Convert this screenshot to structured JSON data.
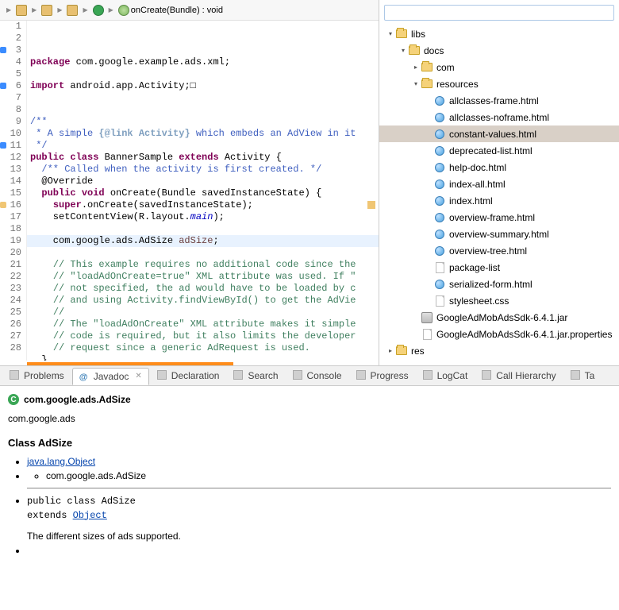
{
  "breadcrumb": {
    "method": "onCreate(Bundle) : void"
  },
  "code": {
    "lines": [
      {
        "n": 1,
        "segs": [
          {
            "t": "package ",
            "c": "kw"
          },
          {
            "t": "com.google.example.ads.xml;"
          }
        ]
      },
      {
        "n": 2,
        "segs": []
      },
      {
        "n": 3,
        "segs": [
          {
            "t": "import ",
            "c": "kw"
          },
          {
            "t": "android.app.Activity;"
          },
          {
            "t": "□",
            "c": "typ"
          }
        ],
        "mark": "blue"
      },
      {
        "n": 4,
        "segs": []
      },
      {
        "n": 5,
        "segs": []
      },
      {
        "n": 6,
        "segs": [
          {
            "t": "/**",
            "c": "jd"
          }
        ],
        "mark": "blue"
      },
      {
        "n": 7,
        "segs": [
          {
            "t": " * A simple ",
            "c": "jd"
          },
          {
            "t": "{@link Activity}",
            "c": "jdt"
          },
          {
            "t": " which embeds an AdView in it",
            "c": "jd"
          }
        ]
      },
      {
        "n": 8,
        "segs": [
          {
            "t": " */",
            "c": "jd"
          }
        ]
      },
      {
        "n": 9,
        "segs": [
          {
            "t": "public class ",
            "c": "kw"
          },
          {
            "t": "BannerSample "
          },
          {
            "t": "extends ",
            "c": "kw"
          },
          {
            "t": "Activity {"
          }
        ]
      },
      {
        "n": 10,
        "segs": [
          {
            "t": "  "
          },
          {
            "t": "/** Called when the activity is first created. */",
            "c": "jd"
          }
        ]
      },
      {
        "n": 11,
        "segs": [
          {
            "t": "  "
          },
          {
            "t": "@Override",
            "c": "typ"
          }
        ],
        "mark": "blue"
      },
      {
        "n": 12,
        "segs": [
          {
            "t": "  "
          },
          {
            "t": "public void ",
            "c": "kw"
          },
          {
            "t": "onCreate(Bundle savedInstanceState) {"
          }
        ]
      },
      {
        "n": 13,
        "segs": [
          {
            "t": "    "
          },
          {
            "t": "super",
            "c": "kw"
          },
          {
            "t": ".onCreate(savedInstanceState);"
          }
        ]
      },
      {
        "n": 14,
        "segs": [
          {
            "t": "    setContentView(R.layout."
          },
          {
            "t": "main",
            "c": "fld"
          },
          {
            "t": ");"
          }
        ]
      },
      {
        "n": 15,
        "segs": []
      },
      {
        "n": 16,
        "segs": [
          {
            "t": "    com.google.ads.AdSize "
          },
          {
            "t": "adSize",
            "c": "var"
          },
          {
            "t": ";"
          }
        ],
        "hl": true,
        "mark": "yellow"
      },
      {
        "n": 17,
        "segs": []
      },
      {
        "n": 18,
        "segs": [
          {
            "t": "    "
          },
          {
            "t": "// This example requires no additional code since the",
            "c": "cm"
          }
        ]
      },
      {
        "n": 19,
        "segs": [
          {
            "t": "    "
          },
          {
            "t": "// \"loadAdOnCreate=true\" XML attribute was used. If \"",
            "c": "cm"
          }
        ]
      },
      {
        "n": 20,
        "segs": [
          {
            "t": "    "
          },
          {
            "t": "// not specified, the ad would have to be loaded by c",
            "c": "cm"
          }
        ]
      },
      {
        "n": 21,
        "segs": [
          {
            "t": "    "
          },
          {
            "t": "// and using Activity.findViewById() to get the AdVie",
            "c": "cm"
          }
        ]
      },
      {
        "n": 22,
        "segs": [
          {
            "t": "    "
          },
          {
            "t": "//",
            "c": "cm"
          }
        ]
      },
      {
        "n": 23,
        "segs": [
          {
            "t": "    "
          },
          {
            "t": "// The \"loadAdOnCreate\" XML attribute makes it simple",
            "c": "cm"
          }
        ]
      },
      {
        "n": 24,
        "segs": [
          {
            "t": "    "
          },
          {
            "t": "// code is required, but it also limits the developer",
            "c": "cm"
          }
        ]
      },
      {
        "n": 25,
        "segs": [
          {
            "t": "    "
          },
          {
            "t": "// request since a generic AdRequest is used.",
            "c": "cm"
          }
        ]
      },
      {
        "n": 26,
        "segs": [
          {
            "t": "  }"
          }
        ]
      },
      {
        "n": 27,
        "segs": [
          {
            "t": "}"
          }
        ]
      },
      {
        "n": 28,
        "segs": []
      }
    ]
  },
  "tree": [
    {
      "d": 0,
      "ic": "folder",
      "tw": "▾",
      "label": "libs"
    },
    {
      "d": 1,
      "ic": "folder",
      "tw": "▾",
      "label": "docs"
    },
    {
      "d": 2,
      "ic": "folder",
      "tw": "▸",
      "label": "com"
    },
    {
      "d": 2,
      "ic": "folder",
      "tw": "▾",
      "label": "resources"
    },
    {
      "d": 3,
      "ic": "globe",
      "label": "allclasses-frame.html"
    },
    {
      "d": 3,
      "ic": "globe",
      "label": "allclasses-noframe.html"
    },
    {
      "d": 3,
      "ic": "globe",
      "label": "constant-values.html",
      "sel": true
    },
    {
      "d": 3,
      "ic": "globe",
      "label": "deprecated-list.html"
    },
    {
      "d": 3,
      "ic": "globe",
      "label": "help-doc.html"
    },
    {
      "d": 3,
      "ic": "globe",
      "label": "index-all.html"
    },
    {
      "d": 3,
      "ic": "globe",
      "label": "index.html"
    },
    {
      "d": 3,
      "ic": "globe",
      "label": "overview-frame.html"
    },
    {
      "d": 3,
      "ic": "globe",
      "label": "overview-summary.html"
    },
    {
      "d": 3,
      "ic": "globe",
      "label": "overview-tree.html"
    },
    {
      "d": 3,
      "ic": "file",
      "label": "package-list"
    },
    {
      "d": 3,
      "ic": "globe",
      "label": "serialized-form.html"
    },
    {
      "d": 3,
      "ic": "file",
      "label": "stylesheet.css"
    },
    {
      "d": 2,
      "ic": "jar",
      "label": "GoogleAdMobAdsSdk-6.4.1.jar"
    },
    {
      "d": 2,
      "ic": "file",
      "label": "GoogleAdMobAdsSdk-6.4.1.jar.properties"
    },
    {
      "d": 0,
      "ic": "folder",
      "tw": "▸",
      "label": "res"
    }
  ],
  "tabs": [
    {
      "label": "Problems",
      "icon": "problems"
    },
    {
      "label": "Javadoc",
      "icon": "javadoc",
      "active": true
    },
    {
      "label": "Declaration",
      "icon": "decl"
    },
    {
      "label": "Search",
      "icon": "search"
    },
    {
      "label": "Console",
      "icon": "console"
    },
    {
      "label": "Progress",
      "icon": "progress"
    },
    {
      "label": "LogCat",
      "icon": "logcat"
    },
    {
      "label": "Call Hierarchy",
      "icon": "callh"
    },
    {
      "label": "Ta",
      "icon": "tasks"
    }
  ],
  "javadoc": {
    "title": "com.google.ads.AdSize",
    "pkg": "com.google.ads",
    "class_heading": "Class AdSize",
    "hier1": "java.lang.Object",
    "hier2": "com.google.ads.AdSize",
    "sig1": "public class AdSize",
    "sig2": "extends ",
    "sig2_link": "Object",
    "desc": "The different sizes of ads supported."
  },
  "search_placeholder": ""
}
